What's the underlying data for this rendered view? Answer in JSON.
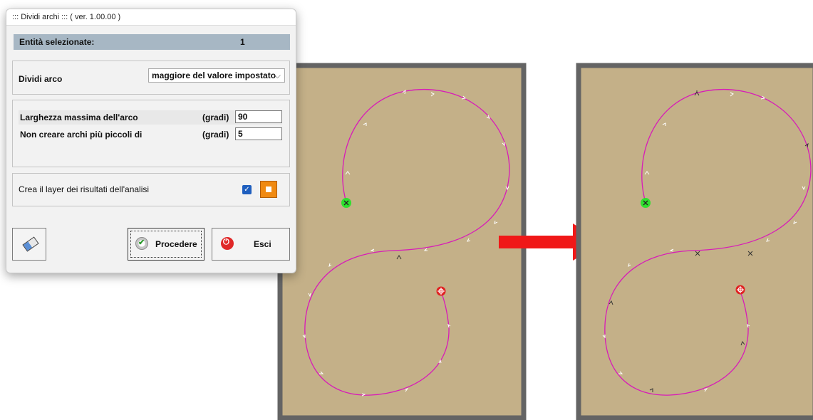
{
  "dialog": {
    "title": "::: Dividi archi ::: ( ver. 1.00.00 )",
    "selection_label": "Entità selezionate:",
    "selection_value": "1",
    "split_label": "Dividi arco",
    "split_mode": "maggiore del valore impostato",
    "param1_label": "Larghezza massima dell'arco",
    "param1_unit": "(gradi)",
    "param1_value": "90",
    "param2_label": "Non creare archi più piccoli di",
    "param2_unit": "(gradi)",
    "param2_value": "5",
    "layer_label": "Crea il layer dei risultati dell'analisi",
    "layer_checked": true,
    "proceed_label": "Procedere",
    "exit_label": "Esci"
  },
  "colors": {
    "panel_bg": "#c4b088",
    "panel_border": "#646464",
    "curve": "#d81bb8",
    "start_marker": "#2ee02e",
    "end_marker": "#e02020",
    "arrow": "#f01818"
  },
  "icons": [
    "eraser-icon",
    "check-icon",
    "power-icon",
    "chevron-down-icon",
    "checkbox-icon"
  ]
}
